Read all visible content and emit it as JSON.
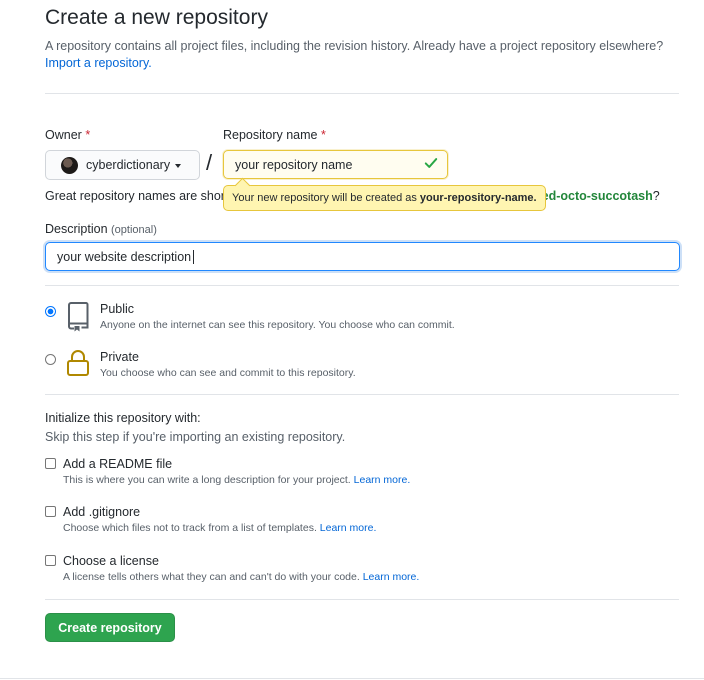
{
  "page": {
    "title": "Create a new repository",
    "intro_text": "A repository contains all project files, including the revision history. Already have a project repository elsewhere?",
    "import_link": "Import a repository."
  },
  "owner": {
    "label": "Owner",
    "required_mark": "*",
    "value": "cyberdictionary"
  },
  "separator": "/",
  "repo_name": {
    "label": "Repository name",
    "required_mark": "*",
    "value": "your repository name",
    "tooltip_prefix": "Your new repository will be created as",
    "tooltip_name": "your-repository-name."
  },
  "name_hint": {
    "text": "Great repository names are shor",
    "suggestion": "ned-octo-succotash",
    "suffix": "?"
  },
  "description": {
    "label": "Description",
    "optional": "(optional)",
    "value": "your website description"
  },
  "visibility": {
    "public": {
      "title": "Public",
      "note": "Anyone on the internet can see this repository. You choose who can commit.",
      "selected": true
    },
    "private": {
      "title": "Private",
      "note": "You choose who can see and commit to this repository.",
      "selected": false
    }
  },
  "init": {
    "heading": "Initialize this repository with:",
    "subheading": "Skip this step if you're importing an existing repository.",
    "options": [
      {
        "title": "Add a README file",
        "note": "This is where you can write a long description for your project.",
        "link": "Learn more.",
        "checked": false
      },
      {
        "title": "Add .gitignore",
        "note": "Choose which files not to track from a list of templates.",
        "link": "Learn more.",
        "checked": false
      },
      {
        "title": "Choose a license",
        "note": "A license tells others what they can and can't do with your code.",
        "link": "Learn more.",
        "checked": false
      }
    ]
  },
  "submit": {
    "label": "Create repository"
  },
  "colors": {
    "primary_button": "#2ea44f",
    "link": "#0366d6",
    "suggestion": "#22863a",
    "tooltip_bg": "#fff5b1",
    "focus_border": "#2188ff"
  }
}
